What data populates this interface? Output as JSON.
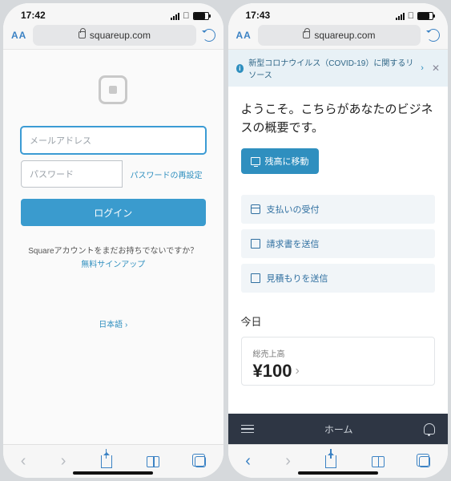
{
  "left": {
    "status_time": "17:42",
    "url_domain": "squareup.com",
    "aa_label": "AA",
    "email_placeholder": "メールアドレス",
    "password_placeholder": "パスワード",
    "reset_password": "パスワードの再設定",
    "login_button": "ログイン",
    "signup_prompt": "Squareアカウントをまだお持ちでないですか？",
    "signup_link": "無料サインアップ",
    "language": "日本語 ›"
  },
  "right": {
    "status_time": "17:43",
    "url_domain": "squareup.com",
    "aa_label": "AA",
    "banner_text": "新型コロナウイルス（COVID-19）に関するリソース",
    "welcome": "ようこそ。こちらがあなたのビジネスの概要です。",
    "move_balance": "残高に移動",
    "action_accept_payment": "支払いの受付",
    "action_send_invoice": "請求書を送信",
    "action_send_estimate": "見積もりを送信",
    "today_heading": "今日",
    "gross_sales_label": "総売上高",
    "gross_sales_amount": "¥100",
    "nav_home": "ホーム"
  }
}
